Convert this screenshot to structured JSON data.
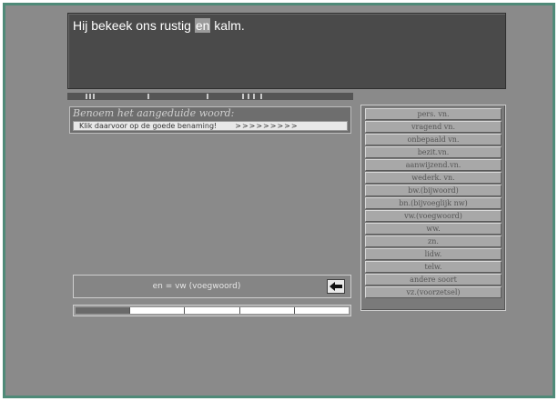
{
  "sentence": {
    "before": "Hij bekeek ons rustig ",
    "highlighted": "en",
    "after": " kalm."
  },
  "prompt": {
    "title": "Benoem het aangeduide woord:",
    "instruction": "Klik daarvoor op de goede benaming!",
    "arrows": ">>>>>>>>>"
  },
  "options": [
    {
      "label": "pers. vn."
    },
    {
      "label": "vragend vn."
    },
    {
      "label": "onbepaald vn."
    },
    {
      "label": "bezit.vn."
    },
    {
      "label": "aanwijzend.vn."
    },
    {
      "label": "wederk. vn."
    },
    {
      "label": "bw.(bijwoord)"
    },
    {
      "label": "bn.(bijvoeglijk nw)"
    },
    {
      "label": "vw.(voegwoord)"
    },
    {
      "label": "ww."
    },
    {
      "label": "zn."
    },
    {
      "label": "lidw."
    },
    {
      "label": "telw."
    },
    {
      "label": "andere soort"
    },
    {
      "label": "vz.(voorzetsel)"
    }
  ],
  "answer": {
    "text": "en = vw (voegwoord)"
  },
  "progress": {
    "segments_total": 5,
    "segments_done": 1
  },
  "colors": {
    "frame": "#4f8a78",
    "background": "#8a8a8a",
    "sentence_panel": "#4a4a4a"
  }
}
